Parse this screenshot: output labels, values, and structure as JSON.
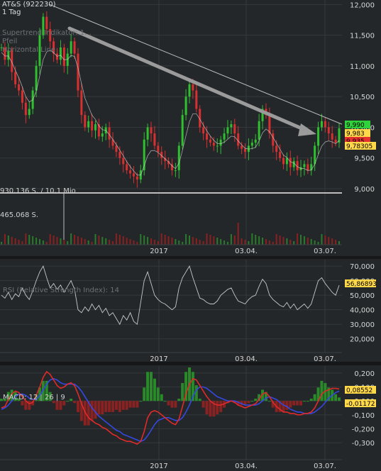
{
  "header": {
    "instrument": "AT&S (922230)",
    "interval": "1 Tag",
    "overlays": [
      "Supertrend Indikator: 1...",
      "Pfeil",
      "Horizontal Line"
    ]
  },
  "price_panel": {
    "y_ticks": [
      "12,000",
      "11,500",
      "11,000",
      "10,500",
      "10,000",
      "9,500",
      "9,000"
    ],
    "labels": {
      "volume_avg": "930.136 S. / 10,1 Mio",
      "volume_max": "465.068 S.",
      "x_ticks": [
        "2017",
        "03.04.",
        "03.07."
      ]
    },
    "badges": {
      "high": "9,990",
      "last": "9,983",
      "low": "9,935",
      "supertrend": "9,78305"
    },
    "colors": {
      "up": "#2fbf2f",
      "down": "#d83030",
      "trend": "#9a9a9a"
    }
  },
  "rsi_panel": {
    "label": "RSI (Relative Strength Index): 14",
    "y_ticks": [
      "70,000",
      "60,000",
      "50,000",
      "40,000",
      "30,000",
      "20,000"
    ],
    "badge": "56,86893",
    "x_ticks": [
      "2017",
      "03.04.",
      "03.07."
    ]
  },
  "macd_panel": {
    "label": "MACD: 12 | 26 | 9",
    "y_ticks": [
      "0,200",
      "0,100",
      "0,000",
      "-0,100",
      "-0,200",
      "-0,300"
    ],
    "badges": {
      "macd": "0,08552",
      "hist": "-0,01172"
    },
    "x_ticks": [
      "2017",
      "03.04.",
      "03.07."
    ]
  },
  "chart_data": [
    {
      "type": "line",
      "title": "AT&S (922230)",
      "xlabel": "",
      "ylabel": "",
      "x_ticks": [
        "2017",
        "03.04.",
        "03.07."
      ],
      "ylim": [
        8700,
        12050
      ],
      "series": [
        {
          "values": [
            11300,
            11100,
            11250,
            10900,
            10700,
            10600,
            10400,
            10200,
            10300,
            10600,
            11000,
            11500,
            11800,
            11600,
            11400,
            11200,
            11100,
            11300,
            11000,
            11200,
            11400,
            11200,
            10600,
            10200,
            10000,
            10100,
            9950,
            10050,
            9850,
            9900,
            10000,
            9800,
            9700,
            9600,
            9500,
            9400,
            9300,
            9250,
            9200,
            9150,
            9300,
            9800,
            10000,
            9900,
            9700,
            9600,
            9500,
            9450,
            9400,
            9300,
            9300,
            9700,
            10200,
            10500,
            10700,
            10600,
            10300,
            10000,
            9900,
            9800,
            9750,
            9700,
            9700,
            9800,
            9900,
            10000,
            10050,
            9900,
            9700,
            9650,
            9600,
            9700,
            9750,
            9800,
            10100,
            10300,
            10200,
            9900,
            9700,
            9600,
            9500,
            9400,
            9500,
            9350,
            9450,
            9300,
            9350,
            9400,
            9300,
            9400,
            9700,
            10000,
            10100,
            10000,
            9900,
            9800,
            9750,
            9983
          ]
        }
      ],
      "horizontal_line": 9180,
      "trend_line": [
        12000,
        10050
      ]
    },
    {
      "type": "line",
      "title": "RSI (Relative Strength Index): 14",
      "ylim": [
        15,
        72
      ],
      "series": [
        {
          "values": [
            50,
            48,
            52,
            47,
            51,
            49,
            55,
            50,
            47,
            53,
            60,
            66,
            70,
            62,
            55,
            58,
            54,
            57,
            52,
            56,
            60,
            54,
            40,
            38,
            42,
            39,
            44,
            40,
            43,
            38,
            41,
            36,
            38,
            34,
            30,
            36,
            33,
            38,
            32,
            30,
            45,
            60,
            66,
            58,
            50,
            47,
            45,
            44,
            42,
            40,
            42,
            55,
            62,
            66,
            70,
            62,
            55,
            48,
            47,
            45,
            44,
            44,
            46,
            50,
            52,
            54,
            55,
            50,
            46,
            45,
            44,
            47,
            49,
            50,
            56,
            61,
            58,
            50,
            47,
            45,
            43,
            42,
            45,
            41,
            44,
            40,
            42,
            44,
            41,
            44,
            52,
            60,
            62,
            58,
            55,
            52,
            50,
            56.87
          ]
        }
      ]
    },
    {
      "type": "line",
      "title": "MACD: 12 | 26 | 9",
      "ylim": [
        -0.34,
        0.23
      ],
      "series": [
        {
          "values": [
            -0.05,
            -0.04,
            0.01,
            0.05,
            0.07,
            0.06,
            0.03,
            0.0,
            -0.02,
            -0.01,
            0.04,
            0.1,
            0.17,
            0.21,
            0.19,
            0.15,
            0.11,
            0.09,
            0.1,
            0.12,
            0.13,
            0.11,
            0.05,
            -0.02,
            -0.08,
            -0.12,
            -0.14,
            -0.16,
            -0.17,
            -0.19,
            -0.2,
            -0.22,
            -0.24,
            -0.25,
            -0.27,
            -0.28,
            -0.29,
            -0.29,
            -0.3,
            -0.31,
            -0.29,
            -0.22,
            -0.12,
            -0.08,
            -0.07,
            -0.08,
            -0.1,
            -0.12,
            -0.14,
            -0.16,
            -0.17,
            -0.13,
            -0.04,
            0.05,
            0.12,
            0.16,
            0.15,
            0.11,
            0.07,
            0.03,
            0.0,
            -0.02,
            -0.03,
            -0.03,
            -0.02,
            -0.01,
            0.0,
            -0.01,
            -0.03,
            -0.04,
            -0.05,
            -0.04,
            -0.03,
            -0.02,
            0.01,
            0.05,
            0.06,
            0.03,
            -0.01,
            -0.04,
            -0.06,
            -0.08,
            -0.08,
            -0.09,
            -0.09,
            -0.1,
            -0.1,
            -0.09,
            -0.09,
            -0.08,
            -0.05,
            0.0,
            0.05,
            0.07,
            0.08,
            0.09,
            0.09,
            0.0855
          ]
        },
        {
          "values": [
            -0.06,
            -0.05,
            -0.03,
            0.0,
            0.03,
            0.05,
            0.05,
            0.04,
            0.02,
            0.01,
            0.01,
            0.04,
            0.08,
            0.12,
            0.15,
            0.16,
            0.15,
            0.13,
            0.12,
            0.12,
            0.12,
            0.12,
            0.1,
            0.07,
            0.03,
            -0.01,
            -0.05,
            -0.08,
            -0.11,
            -0.13,
            -0.15,
            -0.17,
            -0.19,
            -0.21,
            -0.22,
            -0.24,
            -0.25,
            -0.26,
            -0.27,
            -0.28,
            -0.29,
            -0.28,
            -0.25,
            -0.21,
            -0.17,
            -0.14,
            -0.13,
            -0.12,
            -0.12,
            -0.13,
            -0.14,
            -0.14,
            -0.12,
            -0.08,
            -0.03,
            0.03,
            0.08,
            0.1,
            0.1,
            0.09,
            0.07,
            0.05,
            0.03,
            0.02,
            0.01,
            0.0,
            0.0,
            0.0,
            -0.01,
            -0.02,
            -0.03,
            -0.03,
            -0.03,
            -0.03,
            -0.02,
            0.0,
            0.02,
            0.03,
            0.02,
            0.01,
            -0.01,
            -0.03,
            -0.04,
            -0.06,
            -0.07,
            -0.08,
            -0.08,
            -0.09,
            -0.09,
            -0.09,
            -0.08,
            -0.06,
            -0.04,
            -0.01,
            0.02,
            0.04,
            0.06,
            0.07
          ]
        }
      ]
    }
  ]
}
